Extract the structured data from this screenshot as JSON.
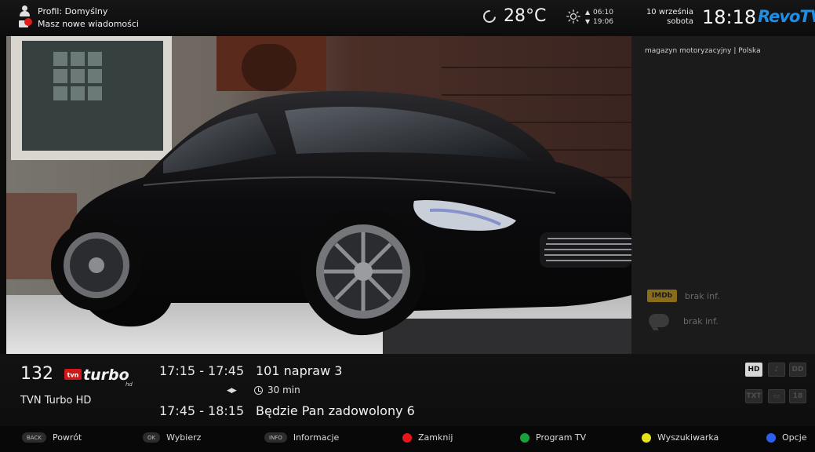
{
  "topbar": {
    "profile_label": "Profil: Domyślny",
    "messages_label": "Masz nowe wiadomości",
    "temperature": "28°C",
    "sunrise": "06:10",
    "sunset": "19:06",
    "date_line1": "10 września",
    "date_line2": "sobota",
    "time": "18:18",
    "logo_text": "RevoTV",
    "icons": [
      "user-icon",
      "message-icon",
      "moon-icon",
      "sun-icon"
    ]
  },
  "info_panel": {
    "genre_country": "magazyn motoryzacyjny | Polska",
    "imdb_label": "IMDb",
    "imdb_value": "brak inf.",
    "reviews_value": "brak inf."
  },
  "channel": {
    "number": "132",
    "name": "TVN Turbo HD",
    "logo_tvn": "tvn",
    "logo_turbo": "turbo",
    "logo_hd": "hd"
  },
  "epg": {
    "current": {
      "time": "17:15 - 17:45",
      "title": "101 napraw 3"
    },
    "duration": "30 min",
    "next": {
      "time": "17:45 - 18:15",
      "title": "Będzie Pan zadowolony 6"
    },
    "flags": [
      {
        "label": "HD",
        "active": true
      },
      {
        "label": "♪",
        "active": false
      },
      {
        "label": "DD",
        "active": false
      },
      {
        "label": "TXT",
        "active": false
      },
      {
        "label": "▭",
        "active": false
      },
      {
        "label": "18",
        "active": false
      }
    ]
  },
  "keys": {
    "back": {
      "badge": "BACK",
      "label": "Powrót"
    },
    "ok": {
      "badge": "OK",
      "label": "Wybierz"
    },
    "info": {
      "badge": "INFO",
      "label": "Informacje"
    },
    "red": {
      "label": "Zamknij",
      "color": "#e8161a"
    },
    "green": {
      "label": "Program TV",
      "color": "#1aa23a"
    },
    "yellow": {
      "label": "Wyszukiwarka",
      "color": "#e6e21a"
    },
    "blue": {
      "label": "Opcje",
      "color": "#2b5ff0"
    }
  },
  "colors": {
    "accent": "#1e8fe6",
    "background": "#0b0b0b",
    "panel": "#1b1b1b"
  }
}
